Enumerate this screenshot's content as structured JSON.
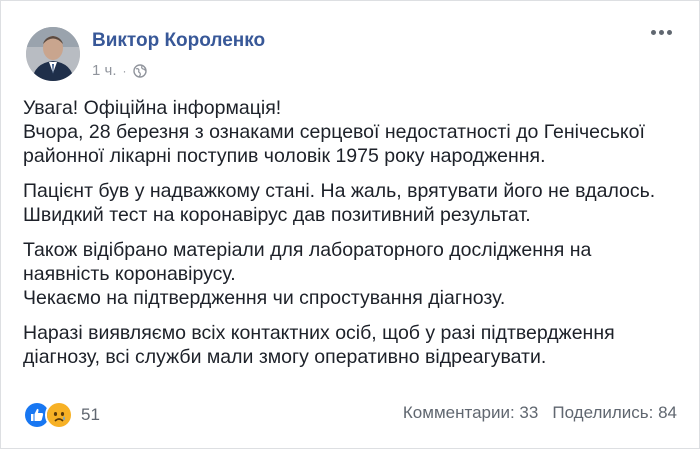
{
  "post": {
    "author": "Виктор Короленко",
    "time": "1 ч.",
    "separator": "·",
    "privacy_icon": "globe-icon",
    "paragraphs": [
      [
        "Увага! Офіційна інформація!",
        "Вчора, 28 березня з ознаками серцевої недостатності до Генічеської",
        "районної лікарні поступив чоловік 1975 року народження."
      ],
      [
        "Пацієнт був у надважкому стані. На жаль, врятувати його не вдалось.",
        "Швидкий тест на коронавірус дав позитивний результат."
      ],
      [
        "Також відібрано матеріали для лабораторного дослідження на",
        "наявність коронавірусу.",
        "Чекаємо на підтвердження чи спростування діагнозу."
      ],
      [
        "Наразі виявляємо всіх контактних осіб, щоб у разі підтвердження",
        "діагнозу, всі служби мали змогу оперативно відреагувати."
      ]
    ]
  },
  "footer": {
    "reaction_icons": [
      "like-icon",
      "sad-icon"
    ],
    "reaction_count": "51",
    "comments": "Комментарии: 33",
    "shares": "Поделились: 84"
  },
  "colors": {
    "link": "#385898",
    "text": "#1d2129",
    "muted": "#606770",
    "like": "#1877f2",
    "sad": "#f7b125"
  }
}
